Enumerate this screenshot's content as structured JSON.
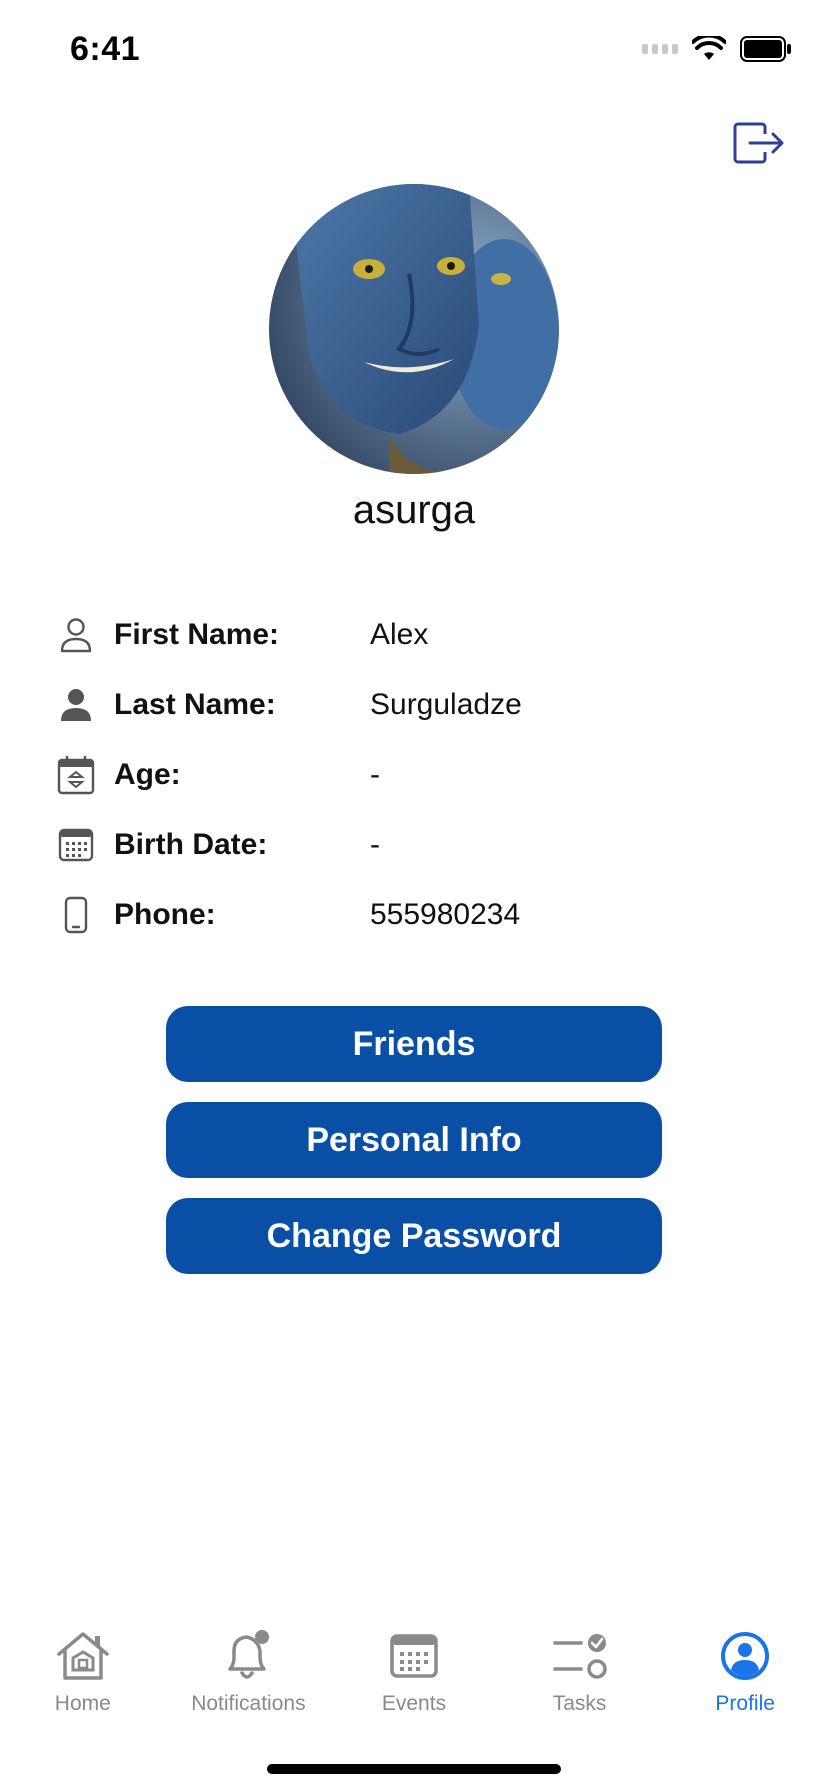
{
  "status_bar": {
    "time": "6:41"
  },
  "profile": {
    "username": "asurga"
  },
  "info": [
    {
      "icon": "person-outline-icon",
      "label": "First Name:",
      "value": "Alex"
    },
    {
      "icon": "person-filled-icon",
      "label": "Last Name:",
      "value": "Surguladze"
    },
    {
      "icon": "calendar-sort-icon",
      "label": "Age:",
      "value": "-"
    },
    {
      "icon": "calendar-grid-icon",
      "label": "Birth Date:",
      "value": "-"
    },
    {
      "icon": "phone-icon",
      "label": "Phone:",
      "value": "555980234"
    }
  ],
  "actions": {
    "friends": "Friends",
    "personal_info": "Personal Info",
    "change_password": "Change Password"
  },
  "tabs": [
    {
      "icon": "home-icon",
      "label": "Home",
      "active": false
    },
    {
      "icon": "bell-badge-icon",
      "label": "Notifications",
      "active": false
    },
    {
      "icon": "calendar-icon",
      "label": "Events",
      "active": false
    },
    {
      "icon": "checklist-icon",
      "label": "Tasks",
      "active": false
    },
    {
      "icon": "person-circle-icon",
      "label": "Profile",
      "active": true
    }
  ],
  "colors": {
    "accent": "#0a4fa6",
    "tab_active": "#1a73e8",
    "tab_inactive": "#8a8a8a",
    "logout_icon": "#2f3e9e"
  }
}
